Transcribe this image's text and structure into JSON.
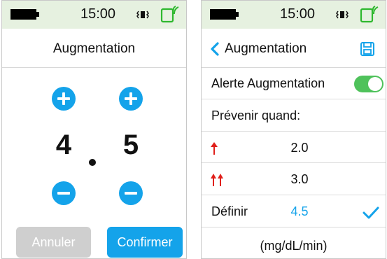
{
  "status_bar": {
    "time": "15:00"
  },
  "left_screen": {
    "title": "Augmentation",
    "digits": [
      "4",
      "5"
    ],
    "cancel_label": "Annuler",
    "confirm_label": "Confirmer"
  },
  "right_screen": {
    "title": "Augmentation",
    "alert_label": "Alerte Augmentation",
    "alert_enabled": true,
    "warn_label": "Prévenir quand:",
    "rows": [
      {
        "value": "2.0"
      },
      {
        "value": "3.0"
      }
    ],
    "define_label": "Définir",
    "define_value": "4.5",
    "unit": "(mg/dL/min)"
  },
  "colors": {
    "accent": "#14a3ea",
    "status_bar": "#e6f1e0",
    "toggle_on": "#4fc25b",
    "arrow_red": "#e0201b",
    "disabled": "#cfcfcf"
  },
  "icons": [
    "battery-icon",
    "vibrate-icon",
    "signal-icon",
    "plus-icon",
    "minus-icon",
    "back-chevron-icon",
    "save-icon",
    "arrow-up-icon",
    "double-arrow-up-icon",
    "checkmark-icon"
  ]
}
